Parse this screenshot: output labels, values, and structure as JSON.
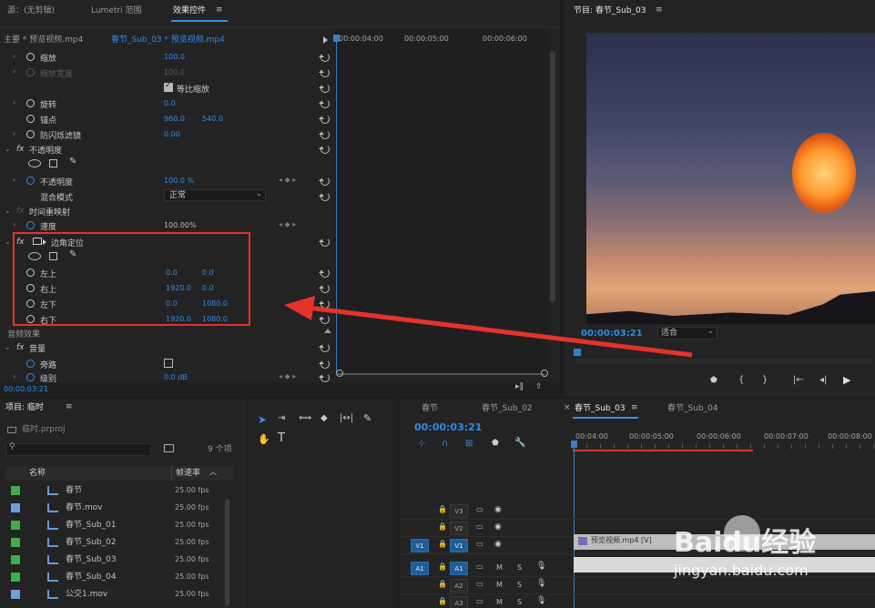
{
  "effects_panel": {
    "tabs": [
      "源：(无剪辑)",
      "Lumetri 范围",
      "效果控件"
    ],
    "source_label": "主要 * 预览视频.mp4",
    "clip_label": "春节_Sub_03 * 预览视频.mp4",
    "timecodes": [
      "00:00:04:00",
      "00:00:05:00",
      "00:00:06:00"
    ],
    "current_time": "00:00:03:21",
    "props": [
      {
        "name": "缩放",
        "v1": "100.0"
      },
      {
        "name": "缩放宽度",
        "v1": "100.0"
      },
      {
        "name": "等比缩放"
      },
      {
        "name": "旋转",
        "v1": "0.0"
      },
      {
        "name": "锚点",
        "v1": "960.0",
        "v2": "540.0"
      },
      {
        "name": "防闪烁滤镜",
        "v1": "0.00"
      },
      {
        "name": "不透明度"
      },
      {
        "name": "不透明度",
        "v1": "100.0 %"
      },
      {
        "name": "混合模式",
        "v1": "正常"
      },
      {
        "name": "时间重映射"
      },
      {
        "name": "速度",
        "v1": "100.00%"
      },
      {
        "name": "边角定位"
      },
      {
        "name": "左上",
        "v1": "0.0",
        "v2": "0.0"
      },
      {
        "name": "右上",
        "v1": "1920.0",
        "v2": "0.0"
      },
      {
        "name": "左下",
        "v1": "0.0",
        "v2": "1080.0"
      },
      {
        "name": "右下",
        "v1": "1920.0",
        "v2": "1080.0"
      },
      {
        "name": "音频效果"
      },
      {
        "name": "音量"
      },
      {
        "name": "旁路"
      },
      {
        "name": "级别",
        "v1": "0.0 dB"
      }
    ],
    "fx_label": "fx"
  },
  "program_monitor": {
    "title": "节目: 春节_Sub_03",
    "timecode": "00:00:03:21",
    "fit": "适合"
  },
  "project_panel": {
    "title": "项目: 临时",
    "file": "临时.prproj",
    "count": "9 个项",
    "col_name": "名称",
    "col_rate": "帧速率",
    "items": [
      {
        "name": "春节",
        "rate": "25.00 fps",
        "color": "#3fae49"
      },
      {
        "name": "春节.mov",
        "rate": "25.00 fps",
        "color": "#6f9fd8"
      },
      {
        "name": "春节_Sub_01",
        "rate": "25.00 fps",
        "color": "#3fae49"
      },
      {
        "name": "春节_Sub_02",
        "rate": "25.00 fps",
        "color": "#3fae49"
      },
      {
        "name": "春节_Sub_03",
        "rate": "25.00 fps",
        "color": "#3fae49"
      },
      {
        "name": "春节_Sub_04",
        "rate": "25.00 fps",
        "color": "#3fae49"
      },
      {
        "name": "公交1.mov",
        "rate": "25.00 fps",
        "color": "#6f9fd8"
      }
    ]
  },
  "timeline": {
    "tabs": [
      "春节",
      "春节_Sub_02",
      "春节_Sub_03",
      "春节_Sub_04"
    ],
    "timecode": "00:00:03:21",
    "ruler": [
      "00:04:00",
      "00:00:05:00",
      "00:00:06:00",
      "00:00:07:00",
      "00:00:08:00"
    ],
    "tracks": [
      "V3",
      "V2",
      "V1",
      "A1",
      "A2",
      "A3"
    ],
    "src_v": "V1",
    "src_a": "A1",
    "clip_label": "预览视频.mp4 [V]",
    "m": "M",
    "s": "S"
  },
  "watermark": {
    "text": "Baidu经验",
    "url": "jingyan.baidu.com"
  }
}
